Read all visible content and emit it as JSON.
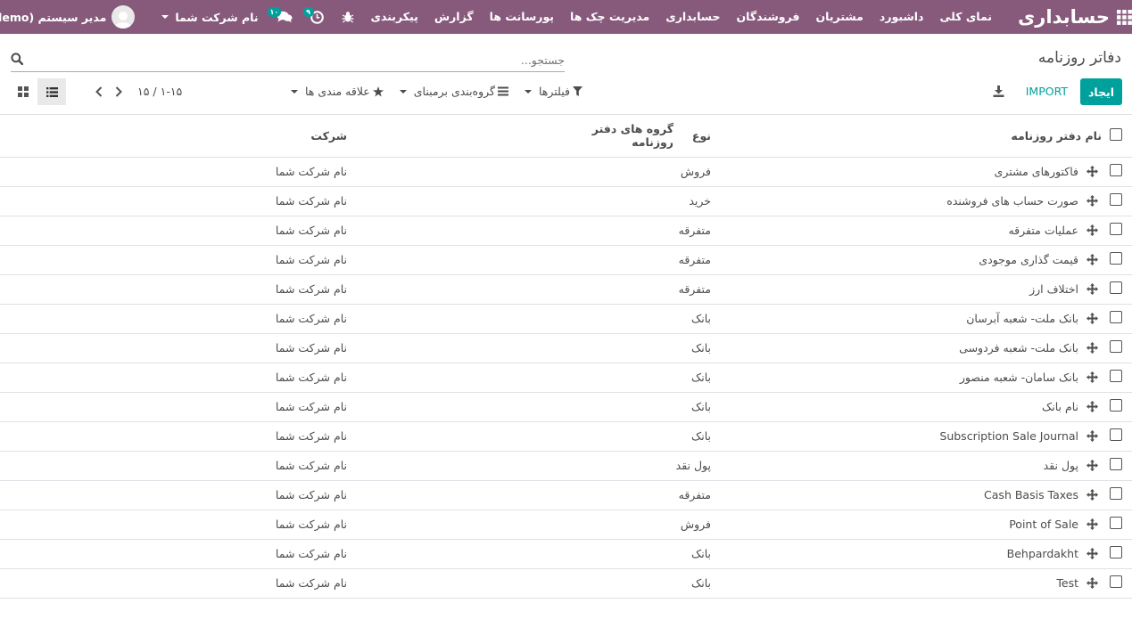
{
  "navbar": {
    "brand": "حسابداری",
    "menu": [
      "نمای کلی",
      "داشبورد",
      "مشتریان",
      "فروشندگان",
      "حسابداری",
      "مدیریت چک ها",
      "پورسانت ها",
      "گزارش",
      "پیکربندی"
    ],
    "activity_badge": "۹",
    "messages_badge": "۱۰",
    "company": "نام شرکت شما",
    "user": "مدیر سیستم (demo)"
  },
  "control": {
    "breadcrumb": "دفاتر روزنامه",
    "search_placeholder": "جستجو...",
    "create_label": "ایجاد",
    "import_label": "IMPORT",
    "filters_label": "فیلترها",
    "groupby_label": "گروه‌بندی برمبنای",
    "favorites_label": "علاقه مندی ها",
    "pager_value": "۱-۱۵ / ۱۵"
  },
  "table": {
    "headers": {
      "name": "نام دفتر روزنامه",
      "type": "نوع",
      "groups": "گروه های دفتر روزنامه",
      "company": "شرکت"
    },
    "rows": [
      {
        "name": "فاکتورهای مشتری",
        "type": "فروش",
        "company": "نام شرکت شما"
      },
      {
        "name": "صورت حساب های فروشنده",
        "type": "خرید",
        "company": "نام شرکت شما"
      },
      {
        "name": "عملیات متفرقه",
        "type": "متفرقه",
        "company": "نام شرکت شما"
      },
      {
        "name": "قیمت گذاری موجودی",
        "type": "متفرقه",
        "company": "نام شرکت شما"
      },
      {
        "name": "اختلاف ارز",
        "type": "متفرقه",
        "company": "نام شرکت شما"
      },
      {
        "name": "بانک ملت- شعبه آبرسان",
        "type": "بانک",
        "company": "نام شرکت شما"
      },
      {
        "name": "بانک ملت- شعبه فردوسی",
        "type": "بانک",
        "company": "نام شرکت شما"
      },
      {
        "name": "بانک سامان- شعبه منصور",
        "type": "بانک",
        "company": "نام شرکت شما"
      },
      {
        "name": "نام بانک",
        "type": "بانک",
        "company": "نام شرکت شما"
      },
      {
        "name": "Subscription Sale Journal",
        "type": "بانک",
        "company": "نام شرکت شما"
      },
      {
        "name": "پول نقد",
        "type": "پول نقد",
        "company": "نام شرکت شما"
      },
      {
        "name": "Cash Basis Taxes",
        "type": "متفرقه",
        "company": "نام شرکت شما"
      },
      {
        "name": "Point of Sale",
        "type": "فروش",
        "company": "نام شرکت شما"
      },
      {
        "name": "Behpardakht",
        "type": "بانک",
        "company": "نام شرکت شما"
      },
      {
        "name": "Test",
        "type": "بانک",
        "company": "نام شرکت شما"
      }
    ]
  },
  "colors": {
    "navbar": "#875a7b",
    "accent": "#00a09d"
  },
  "icons": [
    "apps-grid-icon",
    "bug-icon",
    "clock-icon",
    "chat-icon",
    "user-avatar-icon",
    "search-icon",
    "download-icon",
    "filter-icon",
    "list-icon",
    "star-icon",
    "chevron-left-icon",
    "chevron-right-icon",
    "kanban-view-icon",
    "list-view-icon",
    "drag-handle-icon"
  ]
}
